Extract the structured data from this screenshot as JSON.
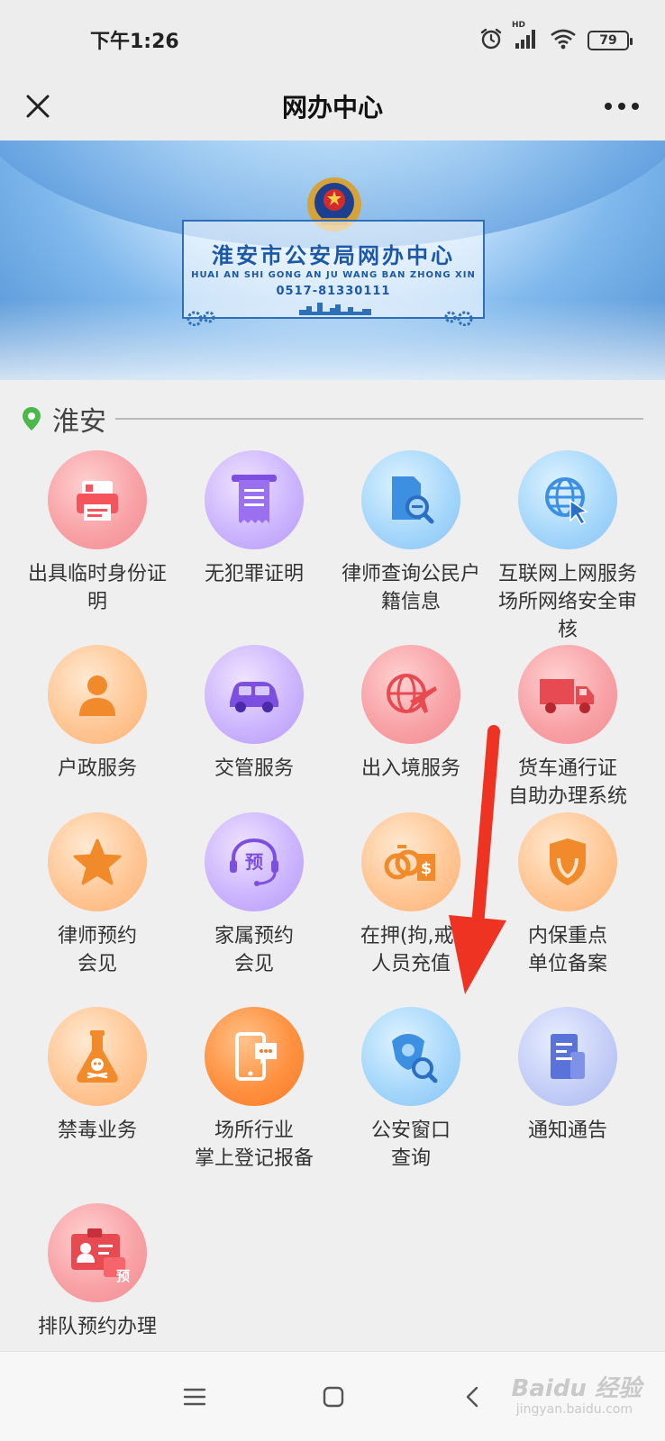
{
  "status_bar": {
    "time": "下午1:26",
    "signal_label": "HD",
    "battery": "79"
  },
  "title_bar": {
    "title": "网办中心"
  },
  "banner": {
    "title": "淮安市公安局网办中心",
    "pinyin": "HUAI AN SHI GONG AN JU WANG BAN ZHONG XIN",
    "phone": "0517-81330111"
  },
  "location": {
    "name": "淮安"
  },
  "services": [
    {
      "label": "出具临时身份证明",
      "icon": "printer-icon",
      "color": "#f28a90"
    },
    {
      "label": "无犯罪证明",
      "icon": "receipt-icon",
      "color": "#b698f6"
    },
    {
      "label": "律师查询公民户籍信息",
      "icon": "document-search-icon",
      "color": "#86c2f3"
    },
    {
      "label": "互联网上网服务场所网络安全审核",
      "icon": "globe-cursor-icon",
      "color": "#86c2f3"
    },
    {
      "label": "户政服务",
      "icon": "person-icon",
      "color": "#ffb274"
    },
    {
      "label": "交管服务",
      "icon": "car-icon",
      "color": "#b698f6"
    },
    {
      "label": "出入境服务",
      "icon": "globe-plane-icon",
      "color": "#f28a90"
    },
    {
      "label": "货车通行证自助办理系统",
      "icon": "truck-icon",
      "color": "#f28a90"
    },
    {
      "label": "律师预约会见",
      "icon": "star-icon",
      "color": "#ffb274"
    },
    {
      "label": "家属预约会见",
      "icon": "headset-icon",
      "color": "#b698f6"
    },
    {
      "label": "在押(拘,戒)人员充值",
      "icon": "handcuffs-money-icon",
      "color": "#ffb274"
    },
    {
      "label": "内保重点单位备案",
      "icon": "shield-icon",
      "color": "#ffb274"
    },
    {
      "label": "禁毒业务",
      "icon": "poison-flask-icon",
      "color": "#ffb274"
    },
    {
      "label": "场所行业掌上登记报备",
      "icon": "phone-chat-icon",
      "color": "#f77a26"
    },
    {
      "label": "公安窗口查询",
      "icon": "police-search-icon",
      "color": "#86c2f3"
    },
    {
      "label": "通知通告",
      "icon": "notice-document-icon",
      "color": "#aab8f0"
    },
    {
      "label": "排队预约办理",
      "icon": "id-card-reserve-icon",
      "color": "#f28a90"
    }
  ],
  "service_label_lines": [
    [
      "出具临时身份证",
      "明"
    ],
    [
      "无犯罪证明"
    ],
    [
      "律师查询公民户",
      "籍信息"
    ],
    [
      "互联网上网服务",
      "场所网络安全审",
      "核"
    ],
    [
      "户政服务"
    ],
    [
      "交管服务"
    ],
    [
      "出入境服务"
    ],
    [
      "货车通行证",
      "自助办理系统"
    ],
    [
      "律师预约",
      "会见"
    ],
    [
      "家属预约",
      "会见"
    ],
    [
      "在押(拘,戒)",
      "人员充值"
    ],
    [
      "内保重点",
      "单位备案"
    ],
    [
      "禁毒业务"
    ],
    [
      "场所行业",
      "掌上登记报备"
    ],
    [
      "公安窗口",
      "查询"
    ],
    [
      "通知通告"
    ],
    [
      "排队预约办理"
    ]
  ],
  "icon_texts": {
    "headset": "预",
    "id_card": "预"
  },
  "watermark": {
    "brand": "Baidu 经验",
    "site": "jingyan.baidu.com"
  }
}
